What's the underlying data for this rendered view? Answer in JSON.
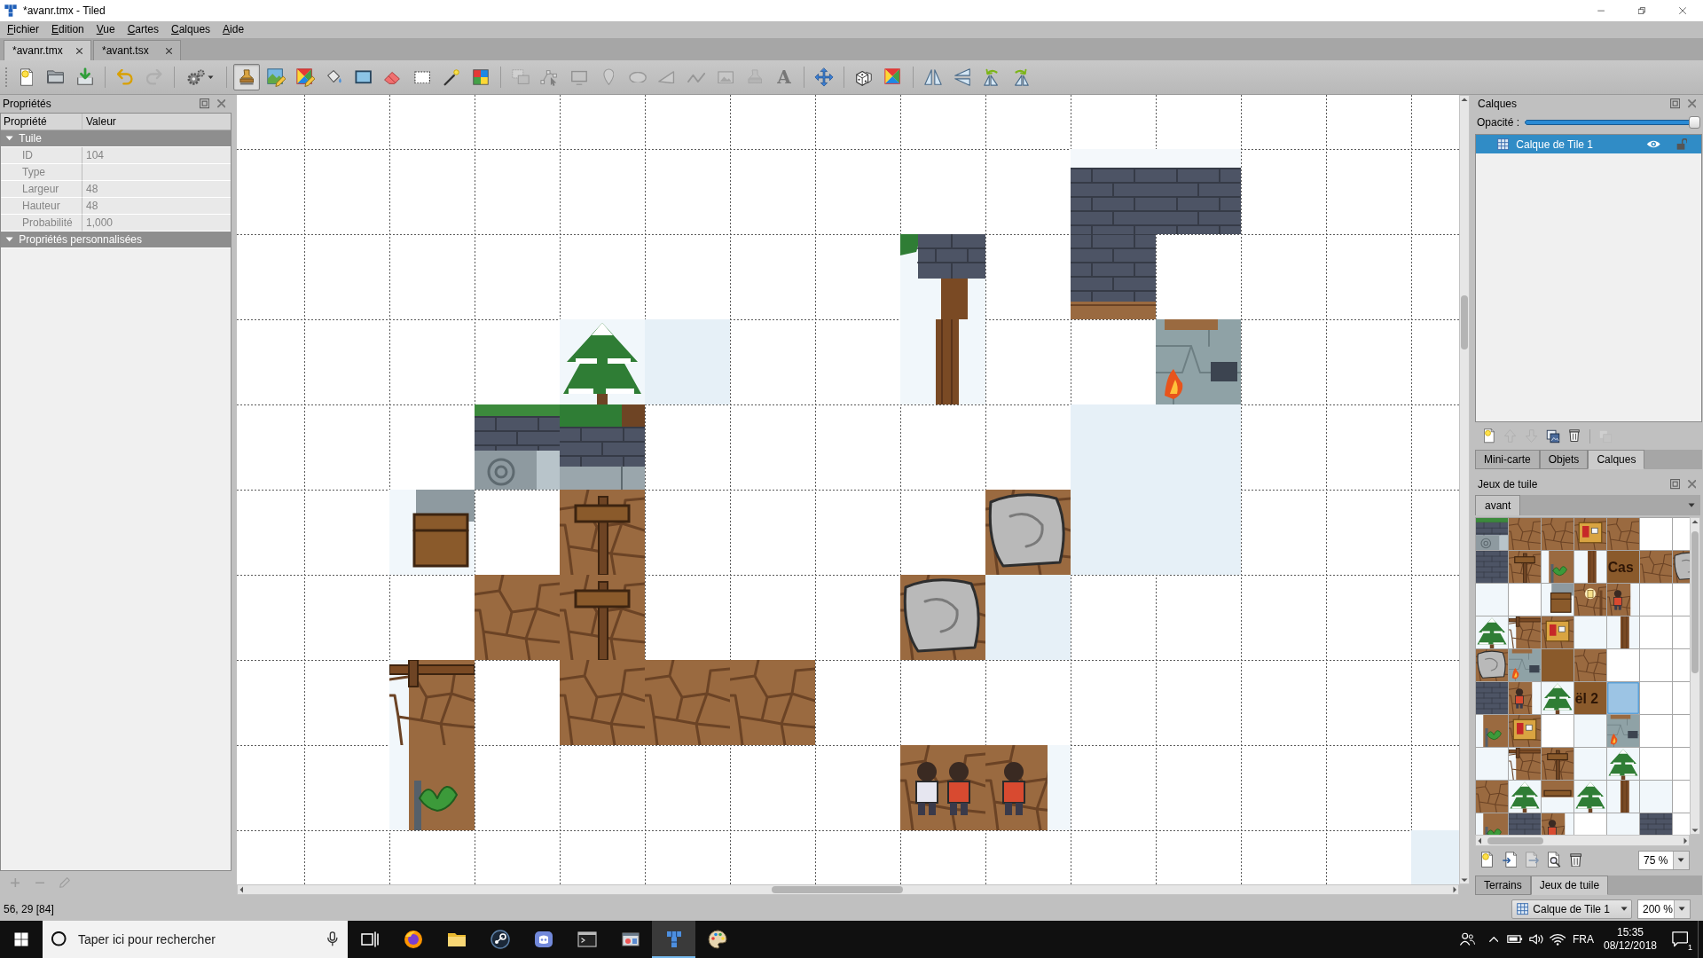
{
  "window": {
    "title": "*avanr.tmx - Tiled"
  },
  "menu": [
    "Fichier",
    "Edition",
    "Vue",
    "Cartes",
    "Calques",
    "Aide"
  ],
  "document_tabs": [
    {
      "label": "*avanr.tmx",
      "selected": true
    },
    {
      "label": "*avant.tsx",
      "selected": false
    }
  ],
  "toolbar": [
    [
      {
        "kind": "new",
        "selected": false,
        "disabled": false
      },
      {
        "kind": "open",
        "selected": false,
        "disabled": false
      },
      {
        "kind": "save",
        "selected": false,
        "disabled": false
      }
    ],
    [
      {
        "kind": "undo",
        "selected": false,
        "disabled": false
      },
      {
        "kind": "redo",
        "selected": false,
        "disabled": true
      }
    ],
    [
      {
        "kind": "commands",
        "selected": false,
        "disabled": false
      }
    ],
    [
      {
        "kind": "stamp",
        "selected": true,
        "disabled": false
      },
      {
        "kind": "terrain",
        "selected": false,
        "disabled": false
      },
      {
        "kind": "wang",
        "selected": false,
        "disabled": false
      },
      {
        "kind": "fill",
        "selected": false,
        "disabled": false
      },
      {
        "kind": "shapefill",
        "selected": false,
        "disabled": false
      },
      {
        "kind": "eraser",
        "selected": false,
        "disabled": false
      },
      {
        "kind": "rectselect",
        "selected": false,
        "disabled": false
      },
      {
        "kind": "wand",
        "selected": false,
        "disabled": false
      },
      {
        "kind": "sametile",
        "selected": false,
        "disabled": false
      }
    ],
    [
      {
        "kind": "select",
        "selected": false,
        "disabled": true
      },
      {
        "kind": "nodes",
        "selected": false,
        "disabled": true
      },
      {
        "kind": "rectangle",
        "selected": false,
        "disabled": true
      },
      {
        "kind": "point",
        "selected": false,
        "disabled": true
      },
      {
        "kind": "ellipse",
        "selected": false,
        "disabled": true
      },
      {
        "kind": "polygon",
        "selected": false,
        "disabled": true
      },
      {
        "kind": "polyline",
        "selected": false,
        "disabled": true
      },
      {
        "kind": "tile",
        "selected": false,
        "disabled": true
      },
      {
        "kind": "template",
        "selected": false,
        "disabled": true
      },
      {
        "kind": "text",
        "glyph": "A",
        "selected": false,
        "disabled": true
      }
    ],
    [
      {
        "kind": "move",
        "selected": false,
        "disabled": false
      }
    ],
    [
      {
        "kind": "random",
        "selected": false,
        "disabled": false
      },
      {
        "kind": "wangfill",
        "selected": false,
        "disabled": false
      }
    ],
    [
      {
        "kind": "fliph",
        "selected": false,
        "disabled": false
      },
      {
        "kind": "flipv",
        "selected": false,
        "disabled": false
      },
      {
        "kind": "rotl",
        "selected": false,
        "disabled": false
      },
      {
        "kind": "rotr",
        "selected": false,
        "disabled": false
      }
    ]
  ],
  "properties": {
    "title": "Propriétés",
    "columns": [
      "Propriété",
      "Valeur"
    ],
    "groups": [
      {
        "label": "Tuile",
        "expanded": true,
        "rows": [
          {
            "name": "ID",
            "value": "104",
            "disabled": true
          },
          {
            "name": "Type",
            "disabled": true
          },
          {
            "name": "Largeur",
            "value": "48",
            "disabled": true
          },
          {
            "name": "Hauteur",
            "value": "48",
            "disabled": true
          },
          {
            "name": "Probabilité",
            "value": "1,000",
            "disabled": true
          }
        ]
      },
      {
        "label": "Propriétés personnalisées",
        "expanded": true
      }
    ],
    "buttons": [
      {
        "kind": "add",
        "disabled": true
      },
      {
        "kind": "remove",
        "disabled": true
      },
      {
        "kind": "rename",
        "disabled": true
      }
    ]
  },
  "layers_panel": {
    "title": "Calques",
    "opacity_label": "Opacité :",
    "opacity": {
      "level": 1
    },
    "layers": [
      {
        "name": "Calque de Tile 1",
        "selected": true,
        "visible": true,
        "locked": false
      }
    ],
    "buttons": [
      [
        {
          "kind": "new",
          "disabled": false
        },
        {
          "kind": "up",
          "disabled": true
        },
        {
          "kind": "down",
          "disabled": true
        },
        {
          "kind": "duplicate",
          "disabled": false
        },
        {
          "kind": "delete",
          "disabled": false
        }
      ],
      [
        {
          "kind": "merge",
          "disabled": true
        }
      ]
    ],
    "tabs": [
      {
        "label": "Mini-carte",
        "selected": false
      },
      {
        "label": "Objets",
        "selected": false
      },
      {
        "label": "Calques",
        "selected": true
      }
    ]
  },
  "tilesets_panel": {
    "title": "Jeux de tuile",
    "tileset_tabs": [
      {
        "label": "avant",
        "selected": true
      }
    ],
    "tiles": [
      {
        "kind": "snowwall",
        "selected": false
      },
      {
        "kind": "dirt",
        "selected": false
      },
      {
        "kind": "dirt",
        "selected": false
      },
      {
        "kind": "notice",
        "selected": false
      },
      {
        "kind": "dirt",
        "selected": false
      },
      {
        "kind": "blank",
        "selected": false
      },
      {
        "kind": "blank",
        "selected": false
      },
      {
        "kind": "wall",
        "selected": false
      },
      {
        "kind": "sign",
        "selected": false
      },
      {
        "kind": "plant",
        "selected": false
      },
      {
        "kind": "trunk",
        "selected": false
      },
      {
        "kind": "label",
        "text": "Cas",
        "selected": false
      },
      {
        "kind": "dirt",
        "selected": false
      },
      {
        "kind": "rock",
        "selected": false
      },
      {
        "kind": "snow",
        "selected": false
      },
      {
        "kind": "blank",
        "selected": false
      },
      {
        "kind": "crate",
        "selected": false
      },
      {
        "kind": "lamp",
        "selected": false
      },
      {
        "kind": "person",
        "selected": false
      },
      {
        "kind": "blank",
        "selected": false
      },
      {
        "kind": "blank",
        "selected": false
      },
      {
        "kind": "tree",
        "selected": false
      },
      {
        "kind": "fence",
        "selected": false
      },
      {
        "kind": "notice",
        "selected": false
      },
      {
        "kind": "snow",
        "selected": false
      },
      {
        "kind": "trunk",
        "selected": false
      },
      {
        "kind": "blank",
        "selected": false
      },
      {
        "kind": "blank",
        "selected": false
      },
      {
        "kind": "rock",
        "selected": false
      },
      {
        "kind": "floor",
        "selected": false
      },
      {
        "kind": "board",
        "selected": false
      },
      {
        "kind": "dirt",
        "selected": false
      },
      {
        "kind": "blank",
        "selected": false
      },
      {
        "kind": "blank",
        "selected": false
      },
      {
        "kind": "blank",
        "selected": false
      },
      {
        "kind": "wall",
        "selected": false
      },
      {
        "kind": "person",
        "selected": false
      },
      {
        "kind": "tree",
        "selected": false
      },
      {
        "kind": "label",
        "text": "ël 2",
        "selected": false
      },
      {
        "kind": "blank",
        "selected": true
      },
      {
        "kind": "blank",
        "selected": false
      },
      {
        "kind": "blank",
        "selected": false
      },
      {
        "kind": "plant",
        "selected": false
      },
      {
        "kind": "notice",
        "selected": false
      },
      {
        "kind": "blank",
        "selected": false
      },
      {
        "kind": "snow",
        "selected": false
      },
      {
        "kind": "floor",
        "selected": false
      },
      {
        "kind": "blank",
        "selected": false
      },
      {
        "kind": "blank",
        "selected": false
      },
      {
        "kind": "snow",
        "selected": false
      },
      {
        "kind": "fence",
        "selected": false
      },
      {
        "kind": "sign",
        "selected": false
      },
      {
        "kind": "snow",
        "selected": false
      },
      {
        "kind": "tree",
        "selected": false
      },
      {
        "kind": "blank",
        "selected": false
      },
      {
        "kind": "blank",
        "selected": false
      },
      {
        "kind": "dirt",
        "selected": false
      },
      {
        "kind": "tree",
        "selected": false
      },
      {
        "kind": "bench",
        "selected": false
      },
      {
        "kind": "tree",
        "selected": false
      },
      {
        "kind": "trunk",
        "selected": false
      },
      {
        "kind": "snow",
        "selected": false
      },
      {
        "kind": "blank",
        "selected": false
      },
      {
        "kind": "plant",
        "selected": false
      },
      {
        "kind": "wall",
        "selected": false
      },
      {
        "kind": "person",
        "selected": false
      },
      {
        "kind": "blank",
        "selected": false
      },
      {
        "kind": "snow",
        "selected": false
      },
      {
        "kind": "wall",
        "selected": false
      },
      {
        "kind": "blank",
        "selected": false
      }
    ],
    "buttons": [
      {
        "kind": "new",
        "disabled": false
      },
      {
        "kind": "import",
        "disabled": false
      },
      {
        "kind": "export",
        "disabled": true
      },
      {
        "kind": "edit",
        "disabled": false
      },
      {
        "kind": "delete",
        "disabled": false
      }
    ],
    "zoom": "75 %",
    "panel_tabs": [
      {
        "label": "Terrains",
        "selected": false
      },
      {
        "label": "Jeux de tuile",
        "selected": true
      }
    ]
  },
  "status_bar": {
    "position": "56, 29 [84]",
    "layer": "Calque de Tile 1",
    "zoom": "200 %"
  },
  "taskbar": {
    "search": {
      "placeholder": "Taper ici pour rechercher"
    },
    "apps": [
      {
        "kind": "taskview",
        "active": false
      },
      {
        "kind": "browser",
        "active": false
      },
      {
        "kind": "files",
        "active": false
      },
      {
        "kind": "steam",
        "active": false
      },
      {
        "kind": "discord",
        "active": false
      },
      {
        "kind": "terminal",
        "active": false
      },
      {
        "kind": "appwin",
        "active": false
      },
      {
        "kind": "tiled",
        "active": true
      },
      {
        "kind": "palette",
        "active": false
      }
    ],
    "language": "FRA",
    "time": "15:35",
    "date": "08/12/2018",
    "notifications": "1"
  }
}
